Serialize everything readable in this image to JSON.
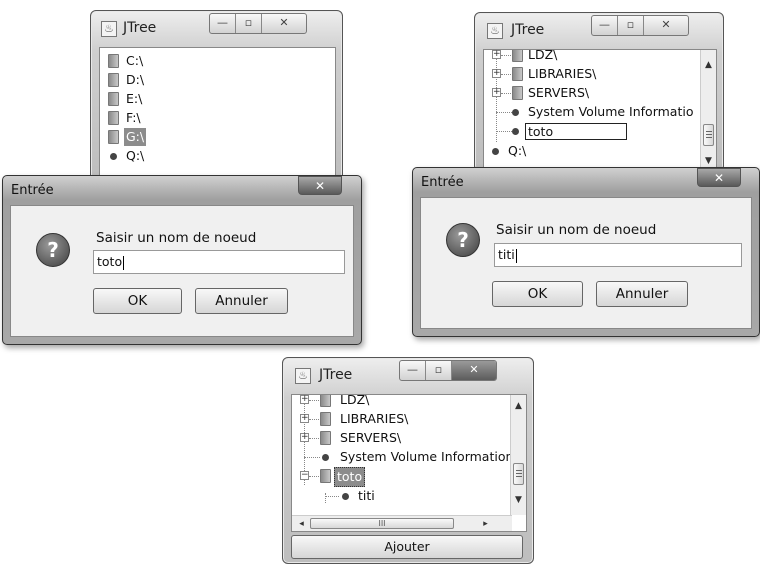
{
  "windows": {
    "tree_title": "JTree",
    "dialog_title": "Entrée",
    "icons": {
      "minimize": "minimize-icon",
      "maximize": "maximize-icon",
      "close": "close-icon",
      "app": "java-cup-icon",
      "question": "question-icon"
    }
  },
  "tree1": {
    "items": [
      {
        "label": "C:\\",
        "type": "folder"
      },
      {
        "label": "D:\\",
        "type": "folder"
      },
      {
        "label": "E:\\",
        "type": "folder"
      },
      {
        "label": "F:\\",
        "type": "folder"
      },
      {
        "label": "G:\\",
        "type": "folder",
        "selected": true
      },
      {
        "label": "Q:\\",
        "type": "leaf"
      }
    ]
  },
  "tree2": {
    "items": [
      {
        "label": "LDZ\\",
        "type": "folder"
      },
      {
        "label": "LIBRARIES\\",
        "type": "folder"
      },
      {
        "label": "SERVERS\\",
        "type": "folder"
      },
      {
        "label": "System Volume Informatio",
        "type": "leaf"
      },
      {
        "label": "toto",
        "type": "leaf",
        "editing": true
      },
      {
        "label": "Q:\\",
        "type": "leaf"
      }
    ]
  },
  "dialog1": {
    "prompt": "Saisir un nom de noeud",
    "value": "toto",
    "ok": "OK",
    "cancel": "Annuler"
  },
  "dialog2": {
    "prompt": "Saisir un nom de noeud",
    "value": "titi",
    "ok": "OK",
    "cancel": "Annuler"
  },
  "tree3": {
    "items": [
      {
        "label": "LDZ\\",
        "type": "folder"
      },
      {
        "label": "LIBRARIES\\",
        "type": "folder"
      },
      {
        "label": "SERVERS\\",
        "type": "folder"
      },
      {
        "label": "System Volume Information",
        "type": "leaf"
      },
      {
        "label": "toto",
        "type": "folder",
        "selected": true
      },
      {
        "label": "titi",
        "type": "leaf"
      }
    ],
    "hscroll_grip": "III",
    "add_button": "Ajouter"
  }
}
